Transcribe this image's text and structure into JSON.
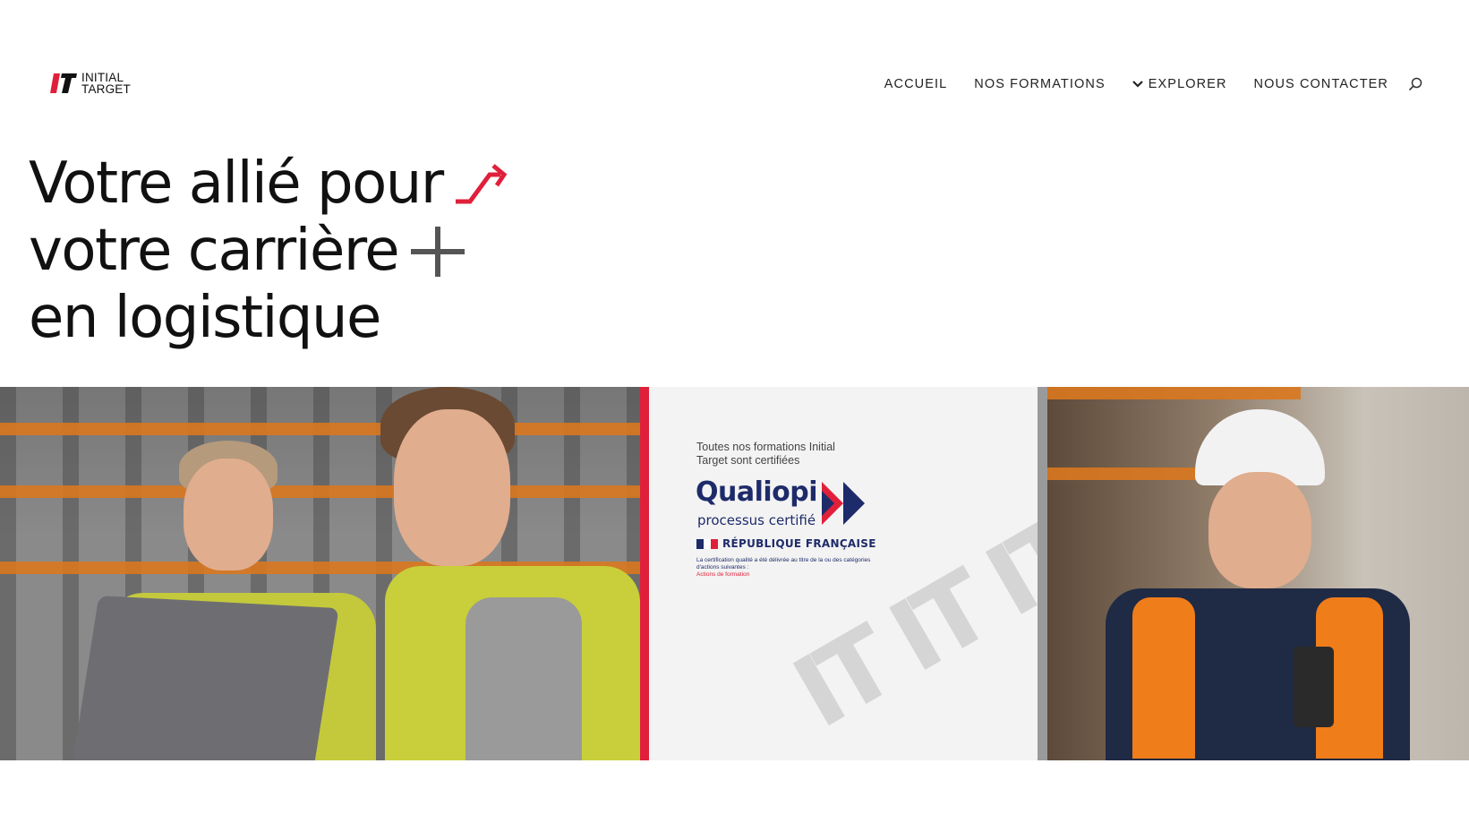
{
  "brand": {
    "line1": "INITIAL",
    "line2": "TARGET",
    "accent_color": "#e0203a"
  },
  "nav": {
    "items": [
      {
        "label": "ACCUEIL"
      },
      {
        "label": "NOS FORMATIONS"
      },
      {
        "label": "EXPLORER",
        "icon": "chevron-down-icon"
      },
      {
        "label": "NOUS CONTACTER"
      }
    ],
    "search_icon": "search-icon"
  },
  "hero": {
    "line1": "Votre allié pour",
    "line2": "votre carrière",
    "line3": "en logistique",
    "icon1": "trend-arrow-icon",
    "icon2": "plus-icon"
  },
  "certification": {
    "intro": "Toutes nos formations Initial Target sont certifiées",
    "brand": "Qualiopi",
    "subtitle": "processus certifié",
    "republic": "RÉPUBLIQUE FRANÇAISE",
    "note": "La certification qualité a été délivrée au titre de la ou des catégories d'actions suivantes :",
    "category": "Actions de formation",
    "watermark": "IT IT IT"
  }
}
